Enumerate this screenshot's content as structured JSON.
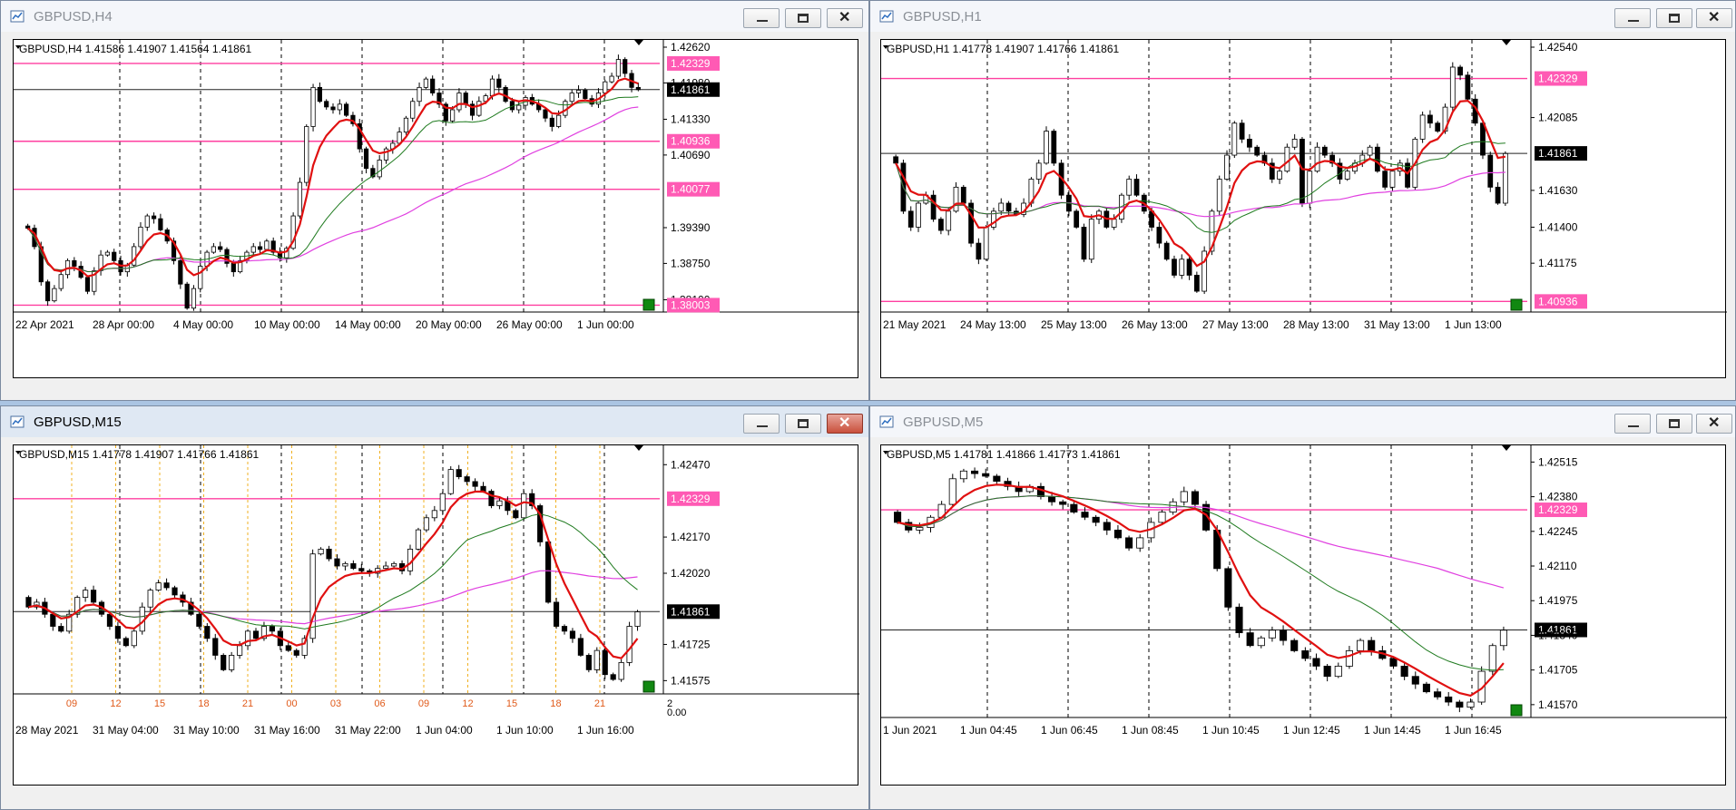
{
  "windows": [
    {
      "key": "h4",
      "title": "GBPUSD,H4",
      "info": "GBPUSD,H4  1.41586 1.41907 1.41564 1.41861",
      "active": false,
      "price_labels": [
        "1.42620",
        "1.42329",
        "1.41980",
        "1.41861",
        "1.41330",
        "1.40936",
        "1.40690",
        "1.40077",
        "1.39390",
        "1.38750",
        "1.38100",
        "1.38003"
      ],
      "time_labels": [
        "22 Apr 2021",
        "28 Apr 00:00",
        "4 May 00:00",
        "10 May 00:00",
        "14 May 00:00",
        "20 May 00:00",
        "26 May 00:00",
        "1 Jun 00:00"
      ],
      "hours": [],
      "chart_data": {
        "type": "candlestick",
        "ylim": [
          1.3788,
          1.4275
        ],
        "current_price": 1.41861,
        "levels": [
          1.42329,
          1.40936,
          1.40077,
          1.38003
        ],
        "close": [
          1.3938,
          1.3905,
          1.3842,
          1.3808,
          1.383,
          1.3855,
          1.388,
          1.387,
          1.385,
          1.3825,
          1.3862,
          1.389,
          1.3895,
          1.388,
          1.386,
          1.3872,
          1.3905,
          1.394,
          1.396,
          1.3955,
          1.3935,
          1.3915,
          1.388,
          1.3838,
          1.3795,
          1.383,
          1.387,
          1.3895,
          1.3905,
          1.39,
          1.3875,
          1.386,
          1.388,
          1.3895,
          1.3905,
          1.39,
          1.3915,
          1.3895,
          1.3885,
          1.3902,
          1.396,
          1.402,
          1.412,
          1.419,
          1.4165,
          1.4155,
          1.415,
          1.416,
          1.414,
          1.4125,
          1.408,
          1.4045,
          1.403,
          1.406,
          1.408,
          1.409,
          1.411,
          1.4135,
          1.4165,
          1.419,
          1.4205,
          1.418,
          1.416,
          1.413,
          1.415,
          1.418,
          1.416,
          1.414,
          1.4165,
          1.4175,
          1.4205,
          1.419,
          1.4165,
          1.415,
          1.4158,
          1.4172,
          1.416,
          1.415,
          1.4135,
          1.412,
          1.414,
          1.4165,
          1.418,
          1.4185,
          1.417,
          1.416,
          1.418,
          1.42,
          1.421,
          1.424,
          1.4215,
          1.419,
          1.4186
        ]
      }
    },
    {
      "key": "h1",
      "title": "GBPUSD,H1",
      "info": "GBPUSD,H1  1.41778 1.41907 1.41766 1.41861",
      "active": false,
      "price_labels": [
        "1.42540",
        "1.42329",
        "1.42085",
        "1.41861",
        "1.41630",
        "1.41400",
        "1.41175",
        "1.40936"
      ],
      "time_labels": [
        "21 May 2021",
        "24 May 13:00",
        "25 May 13:00",
        "26 May 13:00",
        "27 May 13:00",
        "28 May 13:00",
        "31 May 13:00",
        "1 Jun 13:00"
      ],
      "hours": [],
      "chart_data": {
        "type": "candlestick",
        "ylim": [
          1.4087,
          1.4257
        ],
        "current_price": 1.41861,
        "levels": [
          1.42329,
          1.40936
        ],
        "close": [
          1.418,
          1.415,
          1.414,
          1.4155,
          1.416,
          1.4145,
          1.4138,
          1.415,
          1.4165,
          1.4155,
          1.413,
          1.412,
          1.414,
          1.415,
          1.4155,
          1.415,
          1.4148,
          1.4155,
          1.417,
          1.418,
          1.42,
          1.418,
          1.416,
          1.415,
          1.414,
          1.412,
          1.4145,
          1.415,
          1.414,
          1.4145,
          1.416,
          1.417,
          1.416,
          1.415,
          1.414,
          1.413,
          1.412,
          1.411,
          1.412,
          1.411,
          1.41,
          1.4125,
          1.415,
          1.417,
          1.4185,
          1.4205,
          1.4195,
          1.419,
          1.4185,
          1.418,
          1.417,
          1.4175,
          1.419,
          1.4195,
          1.4155,
          1.4175,
          1.419,
          1.4185,
          1.418,
          1.417,
          1.4175,
          1.418,
          1.4185,
          1.419,
          1.4175,
          1.4165,
          1.4175,
          1.418,
          1.4165,
          1.4195,
          1.421,
          1.4205,
          1.42,
          1.4215,
          1.424,
          1.4235,
          1.422,
          1.4205,
          1.4185,
          1.4165,
          1.4155,
          1.4186
        ]
      }
    },
    {
      "key": "m15",
      "title": "GBPUSD,M15",
      "info": "GBPUSD,M15  1.41778 1.41907 1.41766 1.41861",
      "active": true,
      "price_labels": [
        "1.42470",
        "1.42329",
        "1.42170",
        "1.42020",
        "1.41861",
        "1.41725",
        "1.41575"
      ],
      "time_labels": [
        "28 May 2021",
        "31 May 04:00",
        "31 May 10:00",
        "31 May 16:00",
        "31 May 22:00",
        "1 Jun 04:00",
        "1 Jun 10:00",
        "1 Jun 16:00"
      ],
      "hours": [
        "09",
        "12",
        "15",
        "18",
        "21",
        "00",
        "03",
        "06",
        "09",
        "12",
        "15",
        "18",
        "21"
      ],
      "extra_labels": [
        "2",
        "0.00"
      ],
      "chart_data": {
        "type": "candlestick",
        "ylim": [
          1.4152,
          1.4255
        ],
        "current_price": 1.41861,
        "levels": [
          1.42329
        ],
        "close": [
          1.4188,
          1.419,
          1.4185,
          1.418,
          1.4178,
          1.4185,
          1.4192,
          1.4195,
          1.419,
          1.4185,
          1.418,
          1.4175,
          1.4172,
          1.4178,
          1.4188,
          1.4195,
          1.4198,
          1.4196,
          1.4193,
          1.419,
          1.4185,
          1.418,
          1.4175,
          1.4168,
          1.4162,
          1.4168,
          1.4172,
          1.4178,
          1.4175,
          1.418,
          1.4178,
          1.4172,
          1.417,
          1.4168,
          1.4175,
          1.421,
          1.4212,
          1.4208,
          1.4205,
          1.4206,
          1.4204,
          1.4203,
          1.4202,
          1.4204,
          1.4205,
          1.4206,
          1.4203,
          1.4212,
          1.422,
          1.4225,
          1.4228,
          1.4235,
          1.4245,
          1.4242,
          1.424,
          1.4238,
          1.4236,
          1.423,
          1.4232,
          1.4228,
          1.4225,
          1.4235,
          1.423,
          1.4215,
          1.419,
          1.418,
          1.4178,
          1.4175,
          1.4168,
          1.4162,
          1.417,
          1.416,
          1.4158,
          1.4165,
          1.418,
          1.4186
        ]
      }
    },
    {
      "key": "m5",
      "title": "GBPUSD,M5",
      "info": "GBPUSD,M5  1.41781 1.41866 1.41773 1.41861",
      "active": false,
      "price_labels": [
        "1.42515",
        "1.42380",
        "1.42329",
        "1.42245",
        "1.42110",
        "1.41975",
        "1.41861",
        "1.41840",
        "1.41705",
        "1.41570"
      ],
      "time_labels": [
        "1 Jun 2021",
        "1 Jun 04:45",
        "1 Jun 06:45",
        "1 Jun 08:45",
        "1 Jun 10:45",
        "1 Jun 12:45",
        "1 Jun 14:45",
        "1 Jun 16:45"
      ],
      "hours": [],
      "chart_data": {
        "type": "candlestick",
        "ylim": [
          1.4152,
          1.4258
        ],
        "current_price": 1.41861,
        "levels": [
          1.42329
        ],
        "close": [
          1.4228,
          1.4225,
          1.4226,
          1.423,
          1.4235,
          1.4245,
          1.4248,
          1.4247,
          1.4246,
          1.4244,
          1.4242,
          1.424,
          1.4242,
          1.4238,
          1.4236,
          1.4235,
          1.4232,
          1.423,
          1.4228,
          1.4225,
          1.4222,
          1.4218,
          1.4222,
          1.4228,
          1.4232,
          1.4236,
          1.424,
          1.4235,
          1.4225,
          1.421,
          1.4195,
          1.4185,
          1.418,
          1.4183,
          1.4186,
          1.4182,
          1.4178,
          1.4175,
          1.4172,
          1.4168,
          1.4172,
          1.4178,
          1.4182,
          1.4178,
          1.4175,
          1.4172,
          1.4168,
          1.4165,
          1.4162,
          1.416,
          1.4158,
          1.4156,
          1.4158,
          1.417,
          1.418,
          1.4186
        ]
      }
    }
  ]
}
